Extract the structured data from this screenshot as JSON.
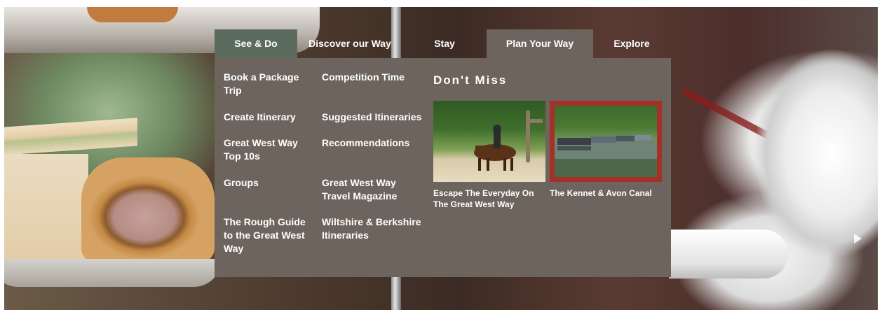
{
  "nav": {
    "tabs": [
      {
        "label": "See & Do",
        "state": "hover"
      },
      {
        "label": "Discover our Way",
        "state": "default"
      },
      {
        "label": "Stay",
        "state": "default"
      },
      {
        "label": "Plan Your Way",
        "state": "active"
      },
      {
        "label": "Explore",
        "state": "default"
      }
    ]
  },
  "menu": {
    "column1": [
      "Book a Package Trip",
      "Create Itinerary",
      "Great West Way Top 10s",
      "Groups",
      "The Rough Guide to the Great West Way"
    ],
    "column2": [
      "Competition Time",
      "Suggested Itineraries",
      "Recommendations",
      "Great West Way Travel Magazine",
      "Wiltshire & Berkshire Itineraries"
    ],
    "dont_miss": {
      "heading": "Don't Miss",
      "cards": [
        {
          "title": "Escape The Everyday On The Great West Way",
          "image_icon": "horse-rider-photo",
          "highlighted": false
        },
        {
          "title": "The Kennet & Avon Canal",
          "image_icon": "canal-boats-photo",
          "highlighted": true
        }
      ]
    }
  },
  "slider": {
    "next_icon": "arrow-right-icon"
  },
  "colors": {
    "panel": "#6d645d",
    "see_do_tab": "#5b6b5e",
    "highlight_border": "#a33127",
    "text": "#ffffff"
  }
}
